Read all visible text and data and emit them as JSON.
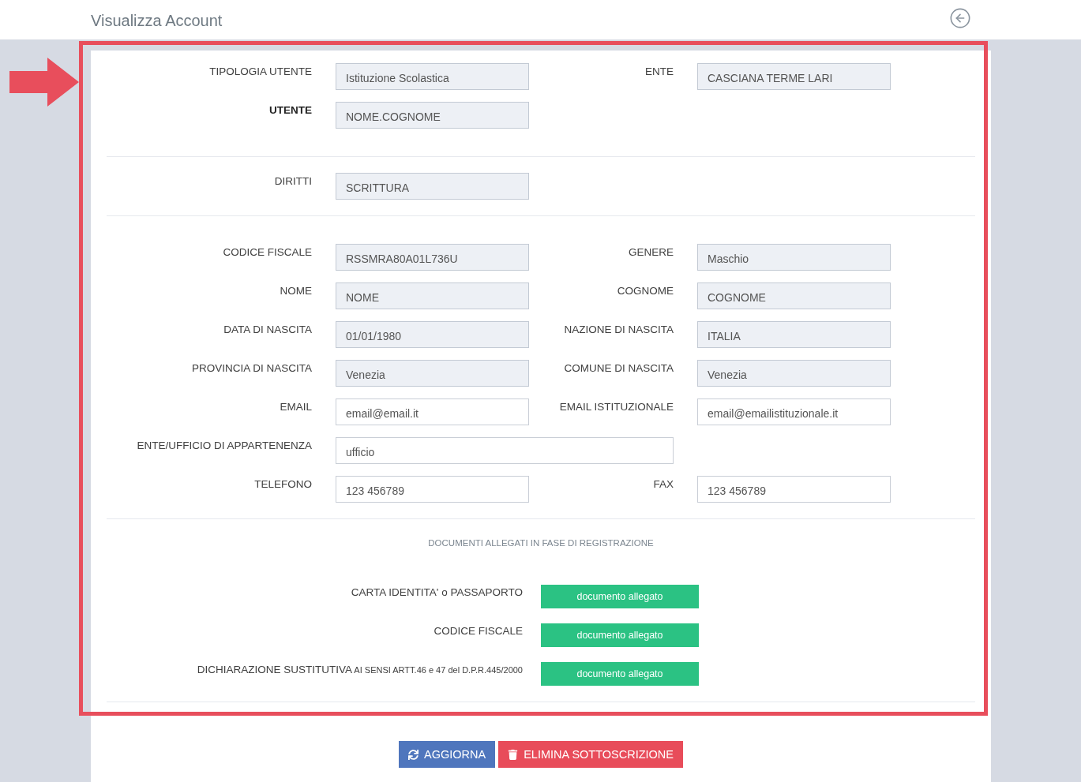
{
  "header": {
    "title": "Visualizza Account"
  },
  "annotation": {
    "highlight_frame": true,
    "arrow": true
  },
  "sections": [
    {
      "rows": [
        {
          "fields": [
            {
              "kind": "field",
              "label": "TIPOLOGIA UTENTE",
              "value": "Istituzione Scolastica",
              "readonly": true,
              "bold": false
            },
            {
              "kind": "field",
              "label": "ENTE",
              "value": "CASCIANA TERME LARI",
              "readonly": true,
              "bold": false
            }
          ]
        },
        {
          "fields": [
            {
              "kind": "field",
              "label": "UTENTE",
              "value": "NOME.COGNOME",
              "readonly": true,
              "bold": true
            }
          ]
        }
      ]
    },
    {
      "rows": [
        {
          "fields": [
            {
              "kind": "field",
              "label": "DIRITTI",
              "value": "SCRITTURA",
              "readonly": true,
              "bold": false
            }
          ]
        }
      ]
    },
    {
      "rows": [
        {
          "fields": [
            {
              "kind": "field",
              "label": "CODICE FISCALE",
              "value": "RSSMRA80A01L736U",
              "readonly": true,
              "bold": false
            },
            {
              "kind": "field",
              "label": "GENERE",
              "value": "Maschio",
              "readonly": true,
              "bold": false
            }
          ]
        },
        {
          "fields": [
            {
              "kind": "field",
              "label": "NOME",
              "value": "NOME",
              "readonly": true,
              "bold": false
            },
            {
              "kind": "field",
              "label": "COGNOME",
              "value": "COGNOME",
              "readonly": true,
              "bold": false
            }
          ]
        },
        {
          "fields": [
            {
              "kind": "field",
              "label": "DATA DI NASCITA",
              "value": "01/01/1980",
              "readonly": true,
              "bold": false
            },
            {
              "kind": "field",
              "label": "NAZIONE DI NASCITA",
              "value": "ITALIA",
              "readonly": true,
              "bold": false
            }
          ]
        },
        {
          "fields": [
            {
              "kind": "field",
              "label": "PROVINCIA DI NASCITA",
              "value": "Venezia",
              "readonly": true,
              "bold": false
            },
            {
              "kind": "field",
              "label": "COMUNE DI NASCITA",
              "value": "Venezia",
              "readonly": true,
              "bold": false
            }
          ]
        },
        {
          "fields": [
            {
              "kind": "field",
              "label": "EMAIL",
              "value": "email@email.it",
              "readonly": false,
              "bold": false
            },
            {
              "kind": "field",
              "label": "EMAIL ISTITUZIONALE",
              "value": "email@emailistituzionale.it",
              "readonly": false,
              "bold": false
            }
          ]
        },
        {
          "fields": [
            {
              "kind": "wide_field",
              "label": "ENTE/UFFICIO DI APPARTENENZA",
              "value": "ufficio",
              "readonly": false,
              "bold": false
            }
          ]
        },
        {
          "fields": [
            {
              "kind": "field",
              "label": "TELEFONO",
              "value": "123 456789",
              "readonly": false,
              "bold": false
            },
            {
              "kind": "field",
              "label": "FAX",
              "value": "123 456789",
              "readonly": false,
              "bold": false
            }
          ]
        }
      ]
    }
  ],
  "documents": {
    "title": "DOCUMENTI ALLEGATI IN FASE DI REGISTRAZIONE",
    "items": [
      {
        "label": "CARTA IDENTITA' o PASSAPORTO",
        "button": "documento allegato"
      },
      {
        "label": "CODICE FISCALE",
        "button": "documento allegato"
      },
      {
        "label": "DICHIARAZIONE SUSTITUTIVA",
        "note": "AI SENSI ARTT.46 e 47 del D.P.R.445/2000",
        "button": "documento allegato"
      }
    ]
  },
  "actions": [
    {
      "kind": "update",
      "label": "AGGIORNA"
    },
    {
      "kind": "delete",
      "label": "ELIMINA SOTTOSCRIZIONE"
    }
  ]
}
